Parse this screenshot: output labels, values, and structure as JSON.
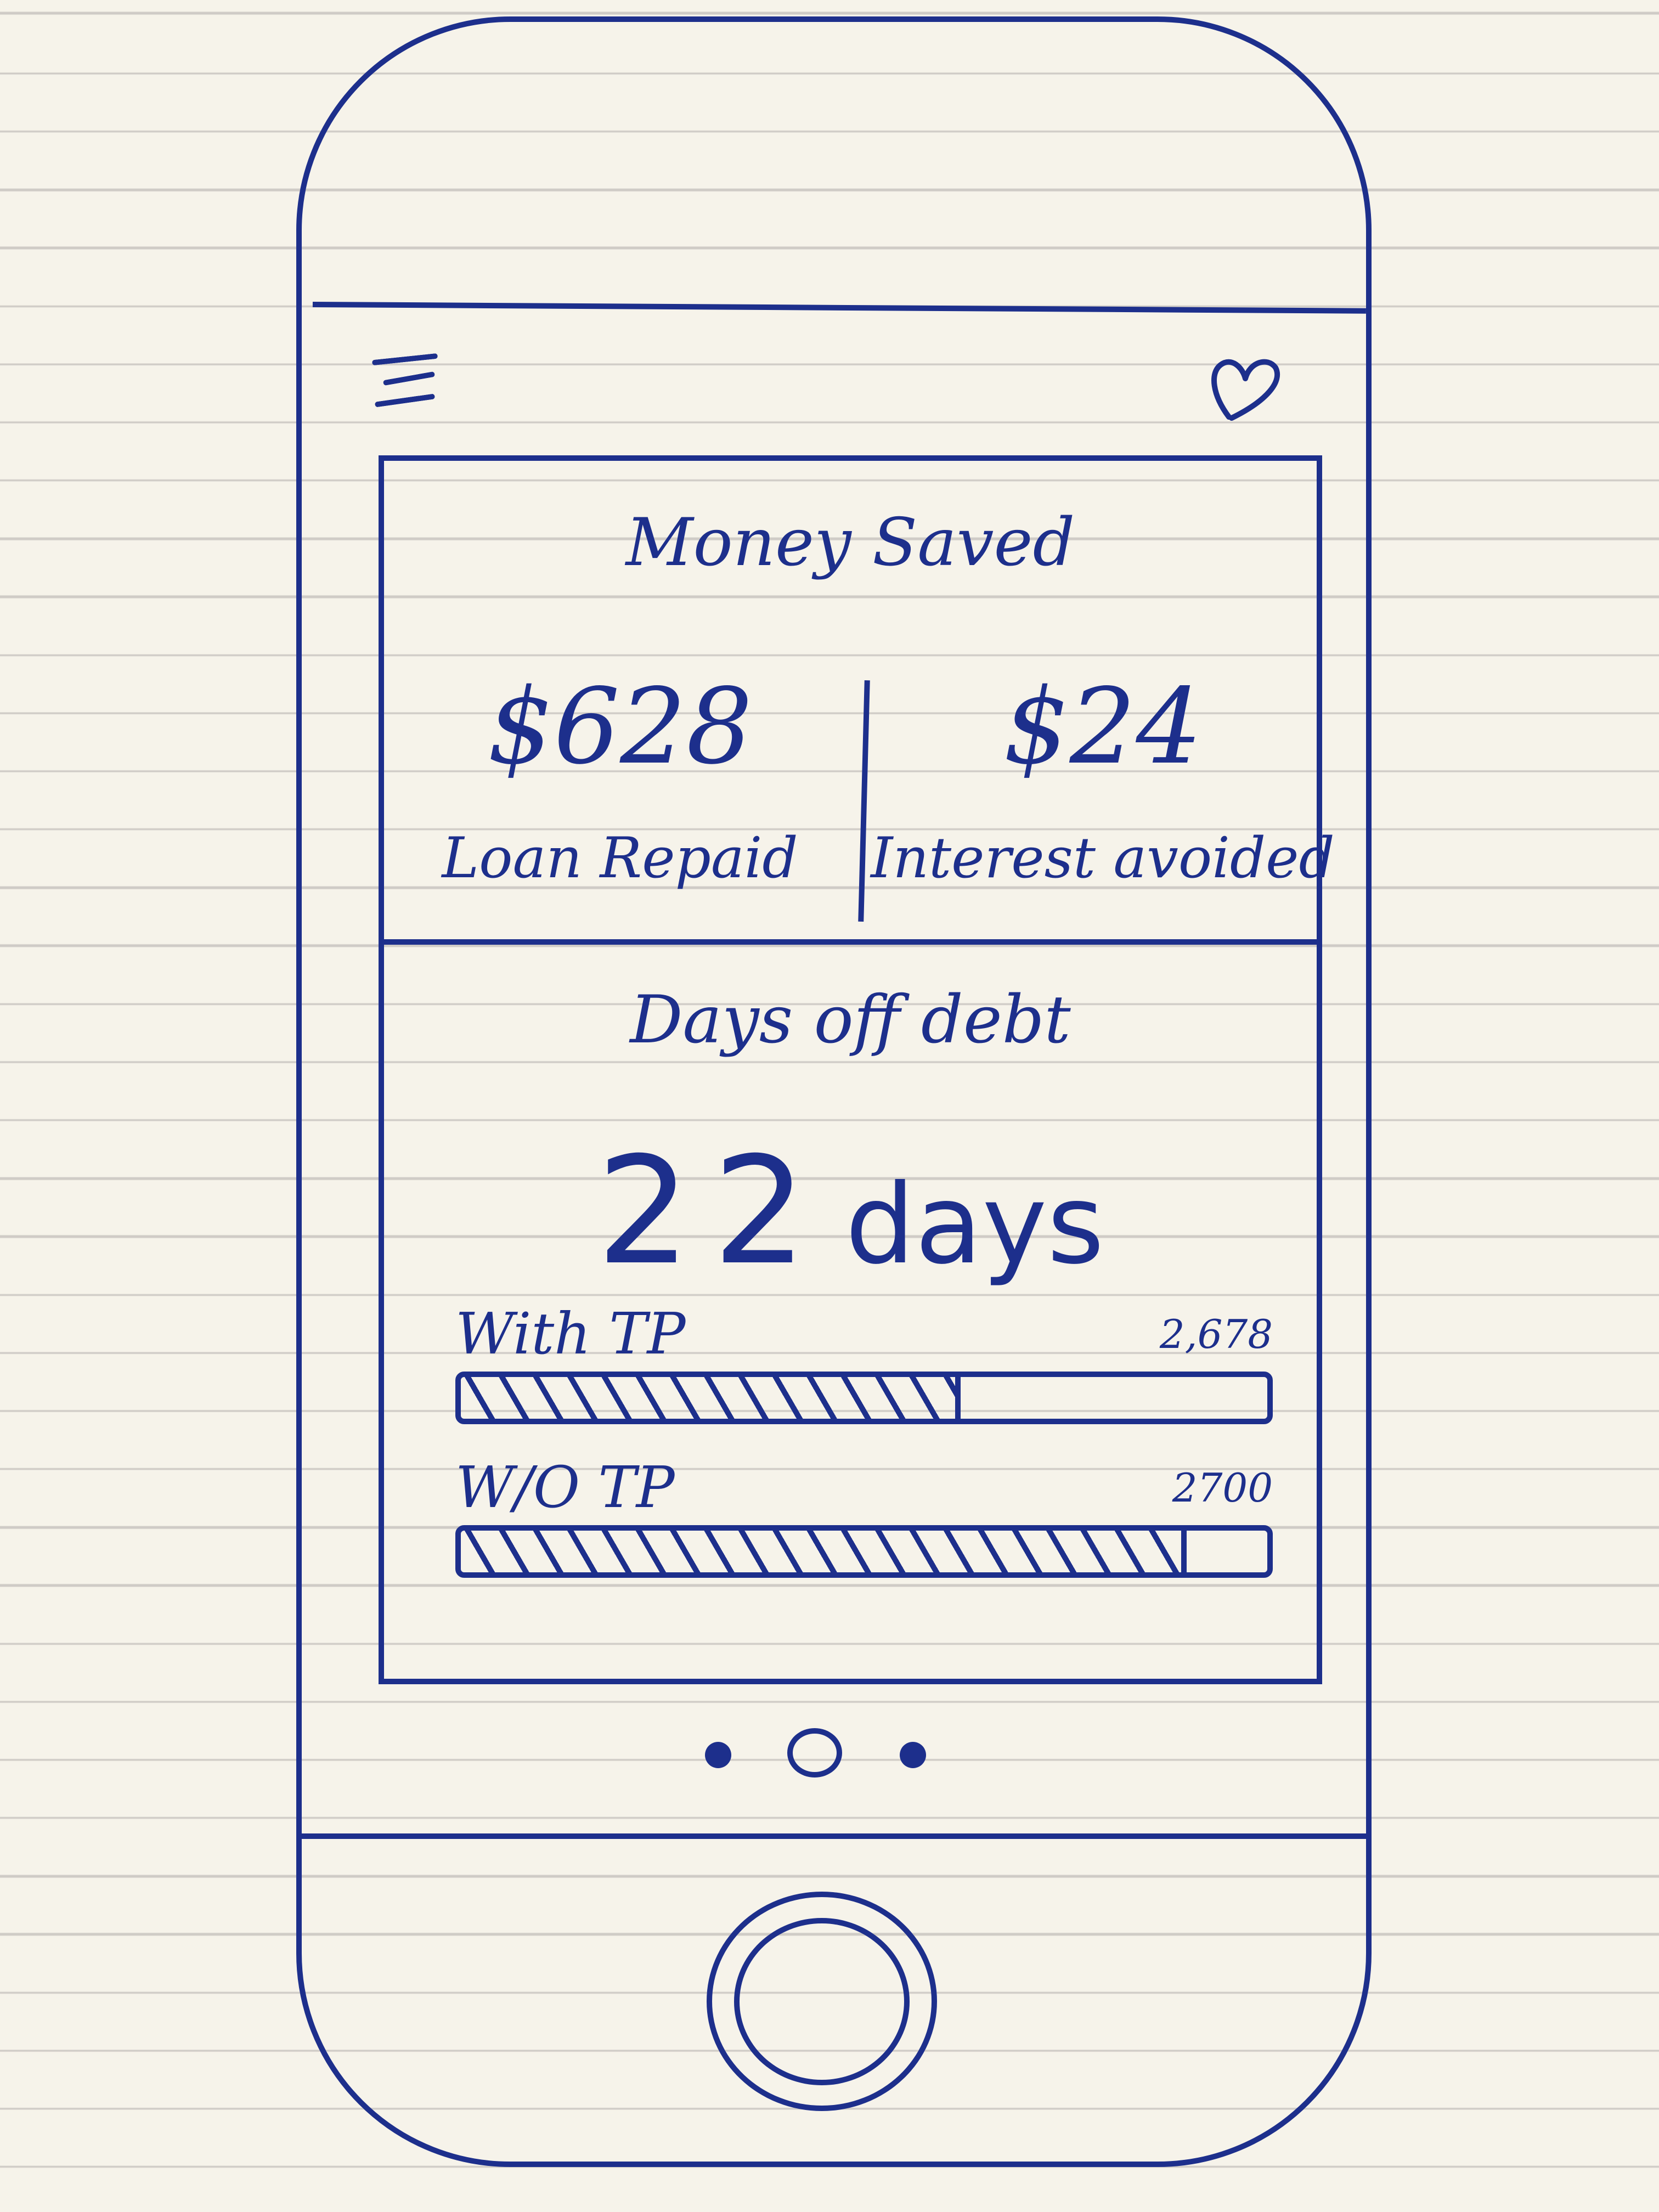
{
  "header": {
    "menu_icon": "hamburger-menu-icon",
    "favorite_icon": "heart-icon"
  },
  "money_saved": {
    "title": "Money Saved",
    "loan_repaid": {
      "value": "$628",
      "label": "Loan Repaid"
    },
    "interest_avoided": {
      "value": "$24",
      "label": "Interest avoided"
    }
  },
  "days_off_debt": {
    "title": "Days off debt",
    "value": "22",
    "unit": "days"
  },
  "progress": [
    {
      "label": "With TP",
      "total": "2,678",
      "fill_fraction": 0.62
    },
    {
      "label": "W/O TP",
      "total": "2700",
      "fill_fraction": 0.9
    }
  ],
  "pagination": {
    "current": 2,
    "total": 3
  },
  "colors": {
    "ink": "#1d2f8c",
    "paper": "#f6f3ea",
    "ruled_line": "#cfcbc6"
  }
}
